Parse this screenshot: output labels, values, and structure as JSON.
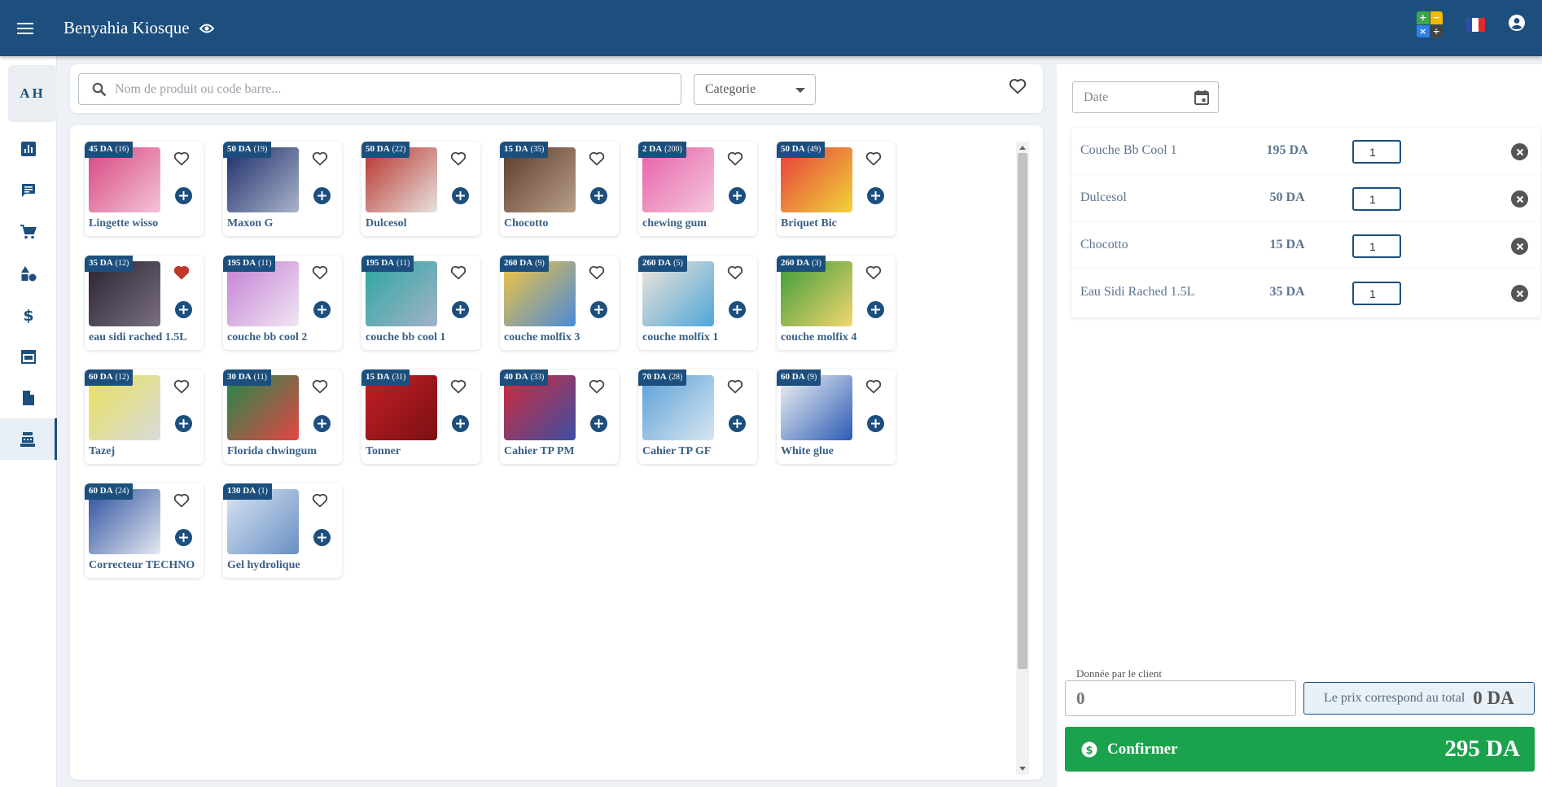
{
  "header": {
    "title": "Benyahia Kiosque",
    "calc_glyphs": [
      "+",
      "−",
      "×",
      "÷"
    ],
    "calc_colors": [
      "#3aa84a",
      "#f5b800",
      "#2f80ed",
      "#444444"
    ],
    "flag_colors": [
      "#2b4ea2",
      "#ffffff",
      "#e02b2b"
    ]
  },
  "sidebar": {
    "avatar_initials": "AH",
    "items": [
      {
        "icon": "chart-icon"
      },
      {
        "icon": "message-icon"
      },
      {
        "icon": "cart-icon"
      },
      {
        "icon": "shapes-icon"
      },
      {
        "icon": "dollar-icon"
      },
      {
        "icon": "store-icon"
      },
      {
        "icon": "document-icon"
      },
      {
        "icon": "cash-register-icon",
        "active": true
      }
    ]
  },
  "search": {
    "placeholder": "Nom de produit ou code barre...",
    "category_label": "Categorie"
  },
  "currency": "DA",
  "products": [
    {
      "price": "45 DA",
      "stock": "(16)",
      "name": "Lingette wisso",
      "fav": false,
      "colors": [
        "#d8457e",
        "#f3c4da"
      ]
    },
    {
      "price": "50 DA",
      "stock": "(19)",
      "name": "Maxon G",
      "fav": false,
      "colors": [
        "#1e2d6b",
        "#a9b4c9"
      ]
    },
    {
      "price": "50 DA",
      "stock": "(22)",
      "name": "Dulcesol",
      "fav": false,
      "colors": [
        "#b8322a",
        "#e7e2df"
      ]
    },
    {
      "price": "15 DA",
      "stock": "(35)",
      "name": "Chocotto",
      "fav": false,
      "colors": [
        "#5b3a2a",
        "#b9a089"
      ]
    },
    {
      "price": "2 DA",
      "stock": "(200)",
      "name": "chewing gum",
      "fav": false,
      "colors": [
        "#e75fa6",
        "#f6c8df"
      ]
    },
    {
      "price": "50 DA",
      "stock": "(49)",
      "name": "Briquet Bic",
      "fav": false,
      "colors": [
        "#e63c3c",
        "#f2d43a"
      ]
    },
    {
      "price": "35 DA",
      "stock": "(12)",
      "name": "eau sidi rached 1.5L",
      "fav": true,
      "colors": [
        "#2a2230",
        "#7a7080"
      ]
    },
    {
      "price": "195 DA",
      "stock": "(11)",
      "name": "couche bb cool 2",
      "fav": false,
      "colors": [
        "#c47fd4",
        "#f0e6f3"
      ]
    },
    {
      "price": "195 DA",
      "stock": "(11)",
      "name": "couche bb cool 1",
      "fav": false,
      "colors": [
        "#2aa6a0",
        "#a3b3c8"
      ]
    },
    {
      "price": "260 DA",
      "stock": "(9)",
      "name": "couche molfix 3",
      "fav": false,
      "colors": [
        "#f4c542",
        "#4a8ad6"
      ]
    },
    {
      "price": "260 DA",
      "stock": "(5)",
      "name": "couche molfix 1",
      "fav": false,
      "colors": [
        "#f1e5d8",
        "#4fa6d8"
      ]
    },
    {
      "price": "260 DA",
      "stock": "(3)",
      "name": "couche molfix 4",
      "fav": false,
      "colors": [
        "#3a9c3a",
        "#f3d66e"
      ]
    },
    {
      "price": "60 DA",
      "stock": "(12)",
      "name": "Tazej",
      "fav": false,
      "colors": [
        "#e8e15a",
        "#d9dadb"
      ]
    },
    {
      "price": "30 DA",
      "stock": "(11)",
      "name": "Florida chwingum",
      "fav": false,
      "colors": [
        "#1e8a4a",
        "#e54545"
      ]
    },
    {
      "price": "15 DA",
      "stock": "(31)",
      "name": "Tonner",
      "fav": false,
      "colors": [
        "#c41f25",
        "#7a1014"
      ]
    },
    {
      "price": "40 DA",
      "stock": "(33)",
      "name": "Cahier TP PM",
      "fav": false,
      "colors": [
        "#d22a3a",
        "#3c4fa3"
      ]
    },
    {
      "price": "70 DA",
      "stock": "(28)",
      "name": "Cahier TP GF",
      "fav": false,
      "colors": [
        "#5aa0d8",
        "#d8e6f0"
      ]
    },
    {
      "price": "60 DA",
      "stock": "(9)",
      "name": "White glue",
      "fav": false,
      "colors": [
        "#f3f3f3",
        "#2b5bb5"
      ]
    },
    {
      "price": "60 DA",
      "stock": "(24)",
      "name": "Correcteur TECHNO",
      "fav": false,
      "colors": [
        "#2c4f9c",
        "#e6e9f2"
      ]
    },
    {
      "price": "130 DA",
      "stock": "(1)",
      "name": "Gel hydrolique",
      "fav": false,
      "colors": [
        "#d8e4f2",
        "#6a8fc4"
      ]
    }
  ],
  "cart": {
    "date_placeholder": "Date",
    "items": [
      {
        "name": "Couche Bb Cool 1",
        "price": "195 DA",
        "qty": "1"
      },
      {
        "name": "Dulcesol",
        "price": "50 DA",
        "qty": "1"
      },
      {
        "name": "Chocotto",
        "price": "15 DA",
        "qty": "1"
      },
      {
        "name": "Eau Sidi Rached 1.5L",
        "price": "35 DA",
        "qty": "1"
      }
    ],
    "given_label": "Donnée par le client",
    "given_placeholder": "0",
    "price_match_label": "Le prix correspond au total",
    "price_match_amount": "0 DA",
    "confirm_label": "Confirmer",
    "total": "295 DA"
  },
  "colors": {
    "primary": "#1c4f7d",
    "confirm": "#1ba24d",
    "heart_fav": "#c0392b"
  }
}
